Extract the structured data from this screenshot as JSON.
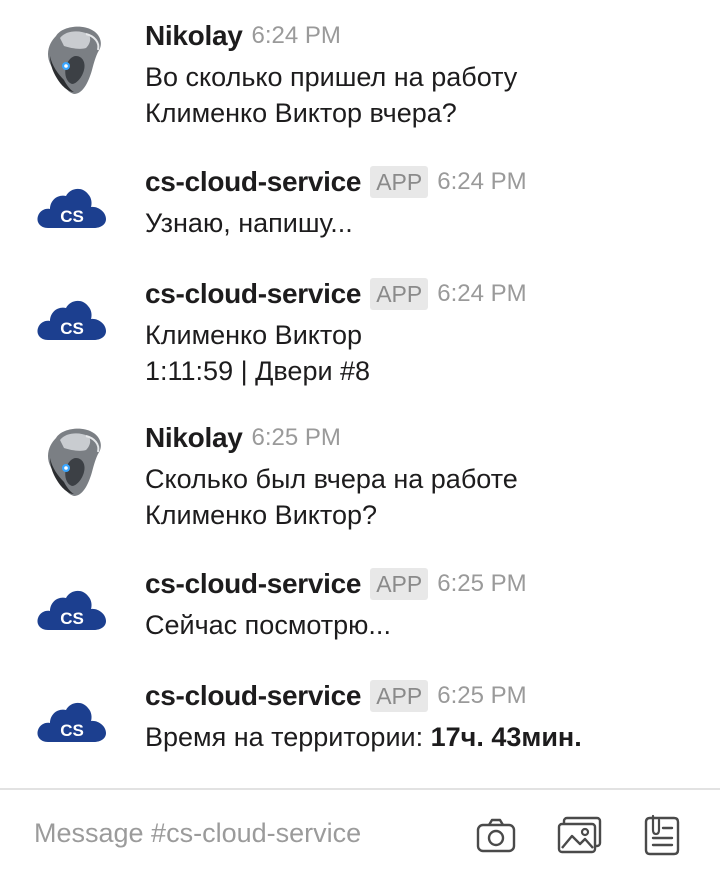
{
  "messages": [
    {
      "sender": "Nikolay",
      "is_app": false,
      "app_badge": "",
      "time": "6:24 PM",
      "lines": [
        "Во сколько пришел на работу",
        "Клименко Виктор вчера?"
      ],
      "avatar": "user-avatar-icon"
    },
    {
      "sender": "cs-cloud-service",
      "is_app": true,
      "app_badge": "APP",
      "time": "6:24 PM",
      "lines": [
        "Узнаю, напишу..."
      ],
      "avatar": "cs-cloud-logo-icon"
    },
    {
      "sender": "cs-cloud-service",
      "is_app": true,
      "app_badge": "APP",
      "time": "6:24 PM",
      "lines": [
        "Клименко Виктор",
        "1:11:59 | Двери #8"
      ],
      "avatar": "cs-cloud-logo-icon"
    },
    {
      "sender": "Nikolay",
      "is_app": false,
      "app_badge": "",
      "time": "6:25 PM",
      "lines": [
        "Сколько был вчера на работе",
        "Клименко Виктор?"
      ],
      "avatar": "user-avatar-icon"
    },
    {
      "sender": "cs-cloud-service",
      "is_app": true,
      "app_badge": "APP",
      "time": "6:25 PM",
      "lines": [
        "Сейчас посмотрю..."
      ],
      "avatar": "cs-cloud-logo-icon"
    },
    {
      "sender": "cs-cloud-service",
      "is_app": true,
      "app_badge": "APP",
      "time": "6:25 PM",
      "lines": [
        "Время на территории: "
      ],
      "bold_suffix": "17ч. 43мин.",
      "avatar": "cs-cloud-logo-icon"
    }
  ],
  "logo_text": "CS",
  "composer": {
    "placeholder": "Message #cs-cloud-service",
    "icons": [
      "camera-icon",
      "image-icon",
      "file-icon"
    ]
  },
  "colors": {
    "cloud_logo": "#1c3f8f",
    "badge_bg": "#e8e8e8",
    "time_gray": "#9a9a9a",
    "divider": "#e2e2e2"
  }
}
